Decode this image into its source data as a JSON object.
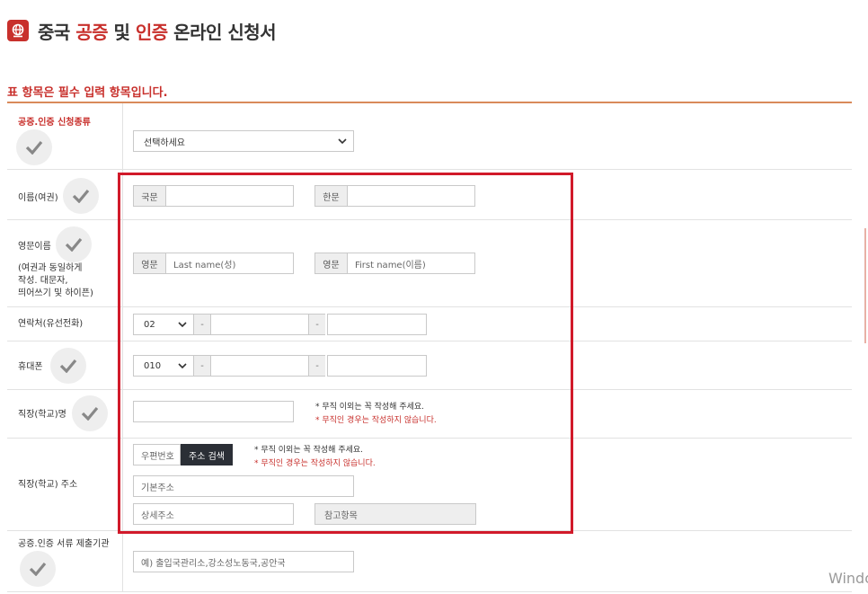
{
  "header": {
    "title_prefix": "중국 ",
    "title_red1": "공증",
    "title_mid": " 및 ",
    "title_red2": "인증",
    "title_suffix": " 온라인 신청서"
  },
  "notice": {
    "text": "표 항목은 필수 입력 항목입니다."
  },
  "fields": {
    "cert_type": {
      "label": "공증.인증 신청종류",
      "value": "선택하세요"
    },
    "name": {
      "label": "이름(여권)",
      "korean_tag": "국문",
      "hanja_tag": "한문"
    },
    "eng_name": {
      "label": "영문이름",
      "help1": "(여권과 동일하게",
      "help2": "작성. 대문자,",
      "help3": "띄어쓰기 및 하이픈)",
      "tag1": "영문",
      "placeholder1": "Last name(성)",
      "tag2": "영문",
      "placeholder2": "First name(이름)"
    },
    "phone": {
      "label": "연락처(유선전화)",
      "area": "02",
      "dash": "-"
    },
    "mobile": {
      "label": "휴대폰",
      "prefix": "010",
      "dash": "-"
    },
    "workplace": {
      "label": "직장(학교)명",
      "note1": "* 무직 이외는 꼭 작성해 주세요.",
      "note2": "* 무직인 경우는 작성하지 않습니다."
    },
    "address": {
      "label": "직장(학교) 주소",
      "zip_placeholder": "우편번호",
      "search_button": "주소 검색",
      "note1": "* 무직 이외는 꼭 작성해 주세요.",
      "note2": "* 무직인 경우는 작성하지 않습니다.",
      "basic_placeholder": "기본주소",
      "detail_placeholder": "상세주소",
      "ref_placeholder": "참고항목"
    },
    "agency": {
      "label": "공증.인증 서류 제출기관",
      "placeholder": "예) 출입국관리소,강소성노동국,공안국"
    }
  },
  "watermark": "Windo",
  "colors": {
    "accent": "#c8302c",
    "highlight": "#d11a2a",
    "button_dark": "#2b2f36"
  },
  "icons": [
    "globe-icon",
    "checkmark-icon",
    "chevron-down-icon"
  ]
}
